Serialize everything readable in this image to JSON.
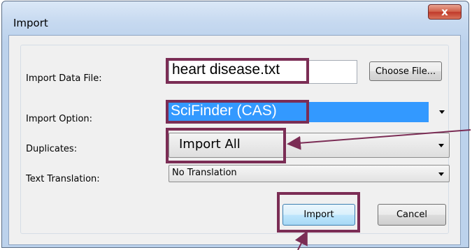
{
  "window": {
    "title": "Import",
    "close_glyph": "x"
  },
  "form": {
    "import_file_label": "Import Data File:",
    "import_file_value": "heart disease.txt",
    "choose_file_label": "Choose File...",
    "import_option_label": "Import Option:",
    "import_option_value": "SciFinder (CAS)",
    "duplicates_label": "Duplicates:",
    "duplicates_value": "Import All",
    "text_translation_label": "Text Translation:",
    "text_translation_value": "No Translation"
  },
  "buttons": {
    "import": "Import",
    "cancel": "Cancel"
  },
  "colors": {
    "highlight": "#7b2d55",
    "selection": "#3399ff"
  }
}
